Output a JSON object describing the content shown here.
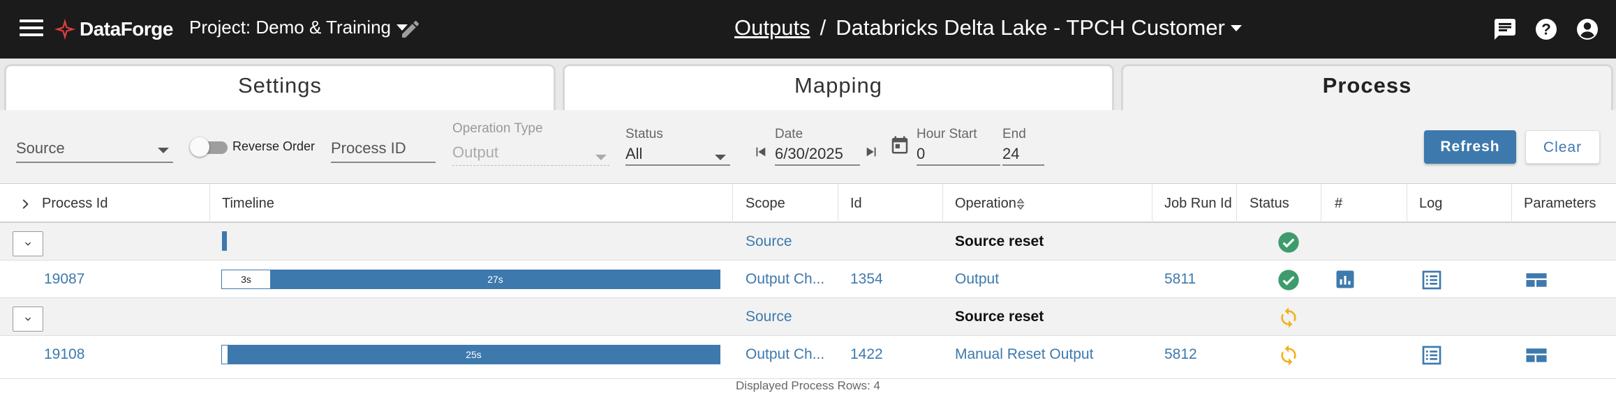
{
  "header": {
    "app_name": "DataForge",
    "project_label": "Project: Demo & Training",
    "breadcrumb_link": "Outputs",
    "breadcrumb_sep": "/",
    "breadcrumb_current": "Databricks Delta Lake - TPCH Customer",
    "icons": [
      "menu-icon",
      "dataforge-logo-icon",
      "pencil-icon",
      "chat-icon",
      "help-icon",
      "account-icon"
    ],
    "colors": {
      "bar": "#1b1b1b",
      "logo_accent": "#e23b3b"
    }
  },
  "tabs": [
    {
      "label": "Settings",
      "active": false
    },
    {
      "label": "Mapping",
      "active": false
    },
    {
      "label": "Process",
      "active": true
    }
  ],
  "filters": {
    "source_placeholder": "Source",
    "reverse_order_label": "Reverse Order",
    "process_id_placeholder": "Process ID",
    "operation_type_label": "Operation Type",
    "operation_type_value": "Output",
    "status_label": "Status",
    "status_value": "All",
    "date_label": "Date",
    "date_value": "6/30/2025",
    "hour_start_label": "Hour Start",
    "hour_start_value": "0",
    "end_label": "End",
    "end_value": "24",
    "refresh_label": "Refresh",
    "clear_label": "Clear"
  },
  "table": {
    "columns": [
      "Process Id",
      "Timeline",
      "Scope",
      "Id",
      "Operation",
      "Job Run Id",
      "Status",
      "#",
      "Log",
      "Parameters"
    ],
    "rows": [
      {
        "kind": "group",
        "scope": "Source",
        "operation": "Source reset",
        "status": "success"
      },
      {
        "kind": "process",
        "process_id": "19087",
        "timeline": [
          {
            "label": "3s",
            "style": "white",
            "fraction": 0.1
          },
          {
            "label": "27s",
            "style": "blue",
            "fraction": 0.9
          }
        ],
        "scope": "Output Ch...",
        "id": "1354",
        "operation": "Output",
        "job_run_id": "5811",
        "status": "success"
      },
      {
        "kind": "group",
        "scope": "Source",
        "operation": "Source reset",
        "status": "in-progress"
      },
      {
        "kind": "process",
        "process_id": "19108",
        "timeline": [
          {
            "label": "",
            "style": "white",
            "fraction": 0.01
          },
          {
            "label": "25s",
            "style": "blue",
            "fraction": 0.99
          }
        ],
        "scope": "Output Ch...",
        "id": "1422",
        "operation": "Manual Reset Output",
        "job_run_id": "5812",
        "status": "in-progress"
      }
    ],
    "footer": "Displayed Process Rows: 4",
    "colors": {
      "link": "#3d79ad",
      "success": "#3e9b6b",
      "in_progress": "#f2b21e"
    }
  }
}
